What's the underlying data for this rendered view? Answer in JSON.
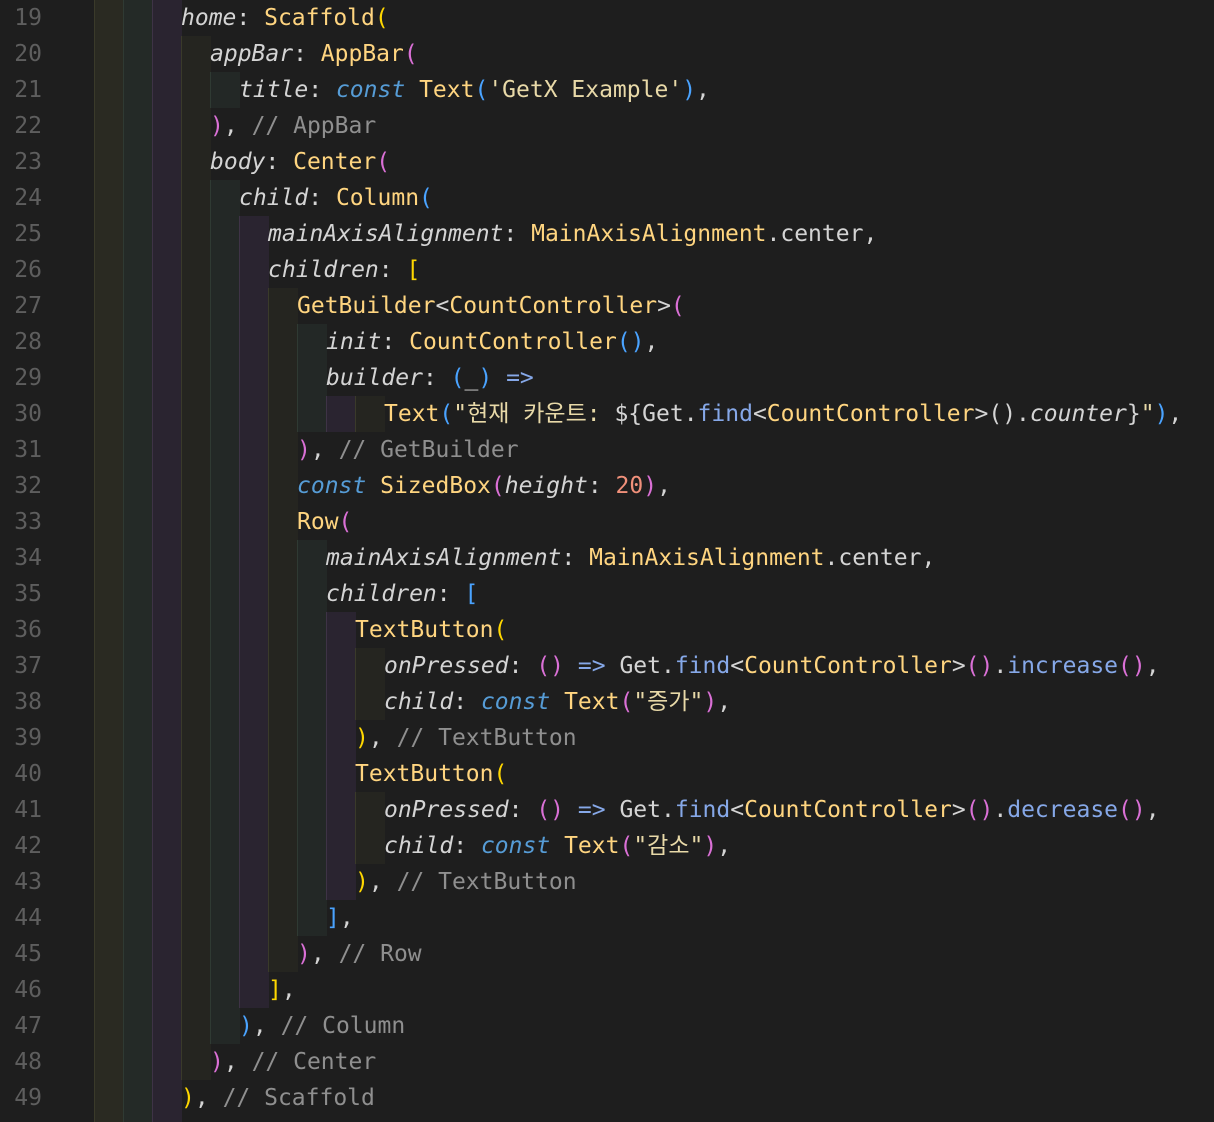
{
  "editor": {
    "language": "Dart",
    "theme_colors": {
      "background": "#1e1e1e",
      "gutter_text": "#5e5e5e",
      "keyword": "#569cd6",
      "class": "#ffd580",
      "string": "#e8d9a8",
      "comment": "#8f8f8f",
      "number": "#f0907a",
      "method": "#86a8e8",
      "bracket_gold": "#ffd700",
      "bracket_pink": "#da70d6",
      "bracket_blue": "#4aa3ff"
    },
    "lines": [
      {
        "num": "19",
        "indent": 0,
        "tokens": [
          [
            "prop",
            "home"
          ],
          [
            "op",
            ": "
          ],
          [
            "cls",
            "Scaffold"
          ],
          [
            "p1",
            "("
          ]
        ]
      },
      {
        "num": "20",
        "indent": 1,
        "tokens": [
          [
            "prop",
            "appBar"
          ],
          [
            "op",
            ": "
          ],
          [
            "cls",
            "AppBar"
          ],
          [
            "p2",
            "("
          ]
        ]
      },
      {
        "num": "21",
        "indent": 2,
        "tokens": [
          [
            "prop",
            "title"
          ],
          [
            "op",
            ": "
          ],
          [
            "k",
            "const"
          ],
          [
            "op",
            " "
          ],
          [
            "cls",
            "Text"
          ],
          [
            "p3",
            "("
          ],
          [
            "str",
            "'GetX Example'"
          ],
          [
            "p3",
            ")"
          ],
          [
            "op",
            ","
          ]
        ]
      },
      {
        "num": "22",
        "indent": 1,
        "tokens": [
          [
            "p2",
            ")"
          ],
          [
            "op",
            ", "
          ],
          [
            "com",
            "// AppBar"
          ]
        ]
      },
      {
        "num": "23",
        "indent": 1,
        "tokens": [
          [
            "prop",
            "body"
          ],
          [
            "op",
            ": "
          ],
          [
            "cls",
            "Center"
          ],
          [
            "p2",
            "("
          ]
        ]
      },
      {
        "num": "24",
        "indent": 2,
        "tokens": [
          [
            "prop",
            "child"
          ],
          [
            "op",
            ": "
          ],
          [
            "cls",
            "Column"
          ],
          [
            "p3",
            "("
          ]
        ]
      },
      {
        "num": "25",
        "indent": 3,
        "tokens": [
          [
            "prop",
            "mainAxisAlignment"
          ],
          [
            "op",
            ": "
          ],
          [
            "cls",
            "MainAxisAlignment"
          ],
          [
            "op",
            ".center,"
          ]
        ]
      },
      {
        "num": "26",
        "indent": 3,
        "tokens": [
          [
            "prop",
            "children"
          ],
          [
            "op",
            ": "
          ],
          [
            "p1",
            "["
          ]
        ]
      },
      {
        "num": "27",
        "indent": 4,
        "tokens": [
          [
            "cls",
            "GetBuilder"
          ],
          [
            "op",
            "<"
          ],
          [
            "cls",
            "CountController"
          ],
          [
            "op",
            ">"
          ],
          [
            "p2",
            "("
          ]
        ]
      },
      {
        "num": "28",
        "indent": 5,
        "tokens": [
          [
            "prop",
            "init"
          ],
          [
            "op",
            ": "
          ],
          [
            "cls",
            "CountController"
          ],
          [
            "p3",
            "()"
          ],
          [
            "op",
            ","
          ]
        ]
      },
      {
        "num": "29",
        "indent": 5,
        "tokens": [
          [
            "prop",
            "builder"
          ],
          [
            "op",
            ": "
          ],
          [
            "p3",
            "("
          ],
          [
            "op",
            "_"
          ],
          [
            "p3",
            ")"
          ],
          [
            "op",
            " "
          ],
          [
            "arrow",
            "=>"
          ]
        ]
      },
      {
        "num": "30",
        "indent": 7,
        "tokens": [
          [
            "cls",
            "Text"
          ],
          [
            "p3",
            "("
          ],
          [
            "str",
            "\"현재 카운트: "
          ],
          [
            "op",
            "${Get."
          ],
          [
            "meth",
            "find"
          ],
          [
            "op",
            "<"
          ],
          [
            "cls",
            "CountController"
          ],
          [
            "op",
            ">()."
          ],
          [
            "prop",
            "counter"
          ],
          [
            "op",
            "}"
          ],
          [
            "str",
            "\""
          ],
          [
            "p3",
            ")"
          ],
          [
            "op",
            ","
          ]
        ]
      },
      {
        "num": "31",
        "indent": 4,
        "tokens": [
          [
            "p2",
            ")"
          ],
          [
            "op",
            ", "
          ],
          [
            "com",
            "// GetBuilder"
          ]
        ]
      },
      {
        "num": "32",
        "indent": 4,
        "tokens": [
          [
            "k",
            "const"
          ],
          [
            "op",
            " "
          ],
          [
            "cls",
            "SizedBox"
          ],
          [
            "p2",
            "("
          ],
          [
            "prop",
            "height"
          ],
          [
            "op",
            ": "
          ],
          [
            "num",
            "20"
          ],
          [
            "p2",
            ")"
          ],
          [
            "op",
            ","
          ]
        ]
      },
      {
        "num": "33",
        "indent": 4,
        "tokens": [
          [
            "cls",
            "Row"
          ],
          [
            "p2",
            "("
          ]
        ]
      },
      {
        "num": "34",
        "indent": 5,
        "tokens": [
          [
            "prop",
            "mainAxisAlignment"
          ],
          [
            "op",
            ": "
          ],
          [
            "cls",
            "MainAxisAlignment"
          ],
          [
            "op",
            ".center,"
          ]
        ]
      },
      {
        "num": "35",
        "indent": 5,
        "tokens": [
          [
            "prop",
            "children"
          ],
          [
            "op",
            ": "
          ],
          [
            "p3",
            "["
          ]
        ]
      },
      {
        "num": "36",
        "indent": 6,
        "tokens": [
          [
            "cls",
            "TextButton"
          ],
          [
            "p1",
            "("
          ]
        ]
      },
      {
        "num": "37",
        "indent": 7,
        "tokens": [
          [
            "prop",
            "onPressed"
          ],
          [
            "op",
            ": "
          ],
          [
            "p2",
            "()"
          ],
          [
            "op",
            " "
          ],
          [
            "arrow",
            "=>"
          ],
          [
            "op",
            " Get."
          ],
          [
            "meth",
            "find"
          ],
          [
            "op",
            "<"
          ],
          [
            "cls",
            "CountController"
          ],
          [
            "op",
            ">"
          ],
          [
            "p2",
            "()"
          ],
          [
            "op",
            "."
          ],
          [
            "meth",
            "increase"
          ],
          [
            "p2",
            "()"
          ],
          [
            "op",
            ","
          ]
        ]
      },
      {
        "num": "38",
        "indent": 7,
        "tokens": [
          [
            "prop",
            "child"
          ],
          [
            "op",
            ": "
          ],
          [
            "k",
            "const"
          ],
          [
            "op",
            " "
          ],
          [
            "cls",
            "Text"
          ],
          [
            "p2",
            "("
          ],
          [
            "str",
            "\"증가\""
          ],
          [
            "p2",
            ")"
          ],
          [
            "op",
            ","
          ]
        ]
      },
      {
        "num": "39",
        "indent": 6,
        "tokens": [
          [
            "p1",
            ")"
          ],
          [
            "op",
            ", "
          ],
          [
            "com",
            "// TextButton"
          ]
        ]
      },
      {
        "num": "40",
        "indent": 6,
        "tokens": [
          [
            "cls",
            "TextButton"
          ],
          [
            "p1",
            "("
          ]
        ]
      },
      {
        "num": "41",
        "indent": 7,
        "tokens": [
          [
            "prop",
            "onPressed"
          ],
          [
            "op",
            ": "
          ],
          [
            "p2",
            "()"
          ],
          [
            "op",
            " "
          ],
          [
            "arrow",
            "=>"
          ],
          [
            "op",
            " Get."
          ],
          [
            "meth",
            "find"
          ],
          [
            "op",
            "<"
          ],
          [
            "cls",
            "CountController"
          ],
          [
            "op",
            ">"
          ],
          [
            "p2",
            "()"
          ],
          [
            "op",
            "."
          ],
          [
            "meth",
            "decrease"
          ],
          [
            "p2",
            "()"
          ],
          [
            "op",
            ","
          ]
        ]
      },
      {
        "num": "42",
        "indent": 7,
        "tokens": [
          [
            "prop",
            "child"
          ],
          [
            "op",
            ": "
          ],
          [
            "k",
            "const"
          ],
          [
            "op",
            " "
          ],
          [
            "cls",
            "Text"
          ],
          [
            "p2",
            "("
          ],
          [
            "str",
            "\"감소\""
          ],
          [
            "p2",
            ")"
          ],
          [
            "op",
            ","
          ]
        ]
      },
      {
        "num": "43",
        "indent": 6,
        "tokens": [
          [
            "p1",
            ")"
          ],
          [
            "op",
            ", "
          ],
          [
            "com",
            "// TextButton"
          ]
        ]
      },
      {
        "num": "44",
        "indent": 5,
        "tokens": [
          [
            "p3",
            "]"
          ],
          [
            "op",
            ","
          ]
        ]
      },
      {
        "num": "45",
        "indent": 4,
        "tokens": [
          [
            "p2",
            ")"
          ],
          [
            "op",
            ", "
          ],
          [
            "com",
            "// Row"
          ]
        ]
      },
      {
        "num": "46",
        "indent": 3,
        "tokens": [
          [
            "p1",
            "]"
          ],
          [
            "op",
            ","
          ]
        ]
      },
      {
        "num": "47",
        "indent": 2,
        "tokens": [
          [
            "p3",
            ")"
          ],
          [
            "op",
            ", "
          ],
          [
            "com",
            "// Column"
          ]
        ]
      },
      {
        "num": "48",
        "indent": 1,
        "tokens": [
          [
            "p2",
            ")"
          ],
          [
            "op",
            ", "
          ],
          [
            "com",
            "// Center"
          ]
        ]
      },
      {
        "num": "49",
        "indent": 0,
        "tokens": [
          [
            "p1",
            ")"
          ],
          [
            "op",
            ", "
          ],
          [
            "com",
            "// Scaffold"
          ]
        ]
      }
    ]
  }
}
